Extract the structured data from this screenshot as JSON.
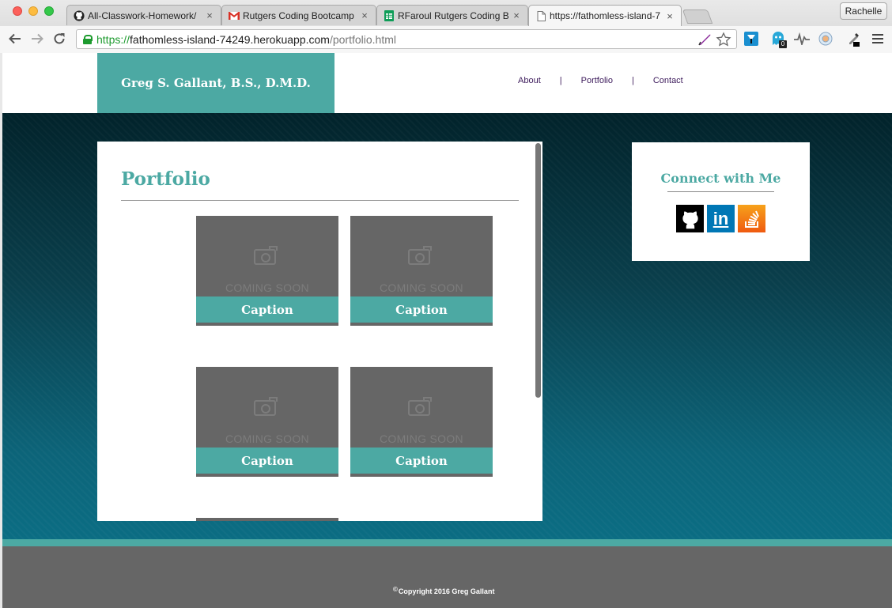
{
  "browser": {
    "tabs": [
      {
        "title": "All-Classwork-Homework/",
        "icon": "github-icon"
      },
      {
        "title": "Rutgers Coding Bootcamp",
        "icon": "gmail-icon"
      },
      {
        "title": "RFaroul Rutgers Coding Bo",
        "icon": "sheets-icon"
      },
      {
        "title": "https://fathomless-island-7",
        "icon": "page-icon"
      }
    ],
    "active_tab": 3,
    "close_glyph": "×",
    "profile_name": "Rachelle",
    "url_scheme": "https://",
    "url_host": "fathomless-island-74249.herokuapp.com",
    "url_path": "/portfolio.html",
    "extension_badge": "0",
    "colors": {
      "secure_green": "#1e9b2f"
    }
  },
  "site": {
    "brand": "Greg S. Gallant, B.S., D.M.D.",
    "nav": {
      "about": "About",
      "portfolio": "Portfolio",
      "contact": "Contact",
      "separator": "|"
    },
    "portfolio": {
      "title": "Portfolio",
      "items": [
        {
          "placeholder": "COMING SOON",
          "caption": "Caption"
        },
        {
          "placeholder": "COMING SOON",
          "caption": "Caption"
        },
        {
          "placeholder": "COMING SOON",
          "caption": "Caption"
        },
        {
          "placeholder": "COMING SOON",
          "caption": "Caption"
        }
      ]
    },
    "connect": {
      "title": "Connect with Me",
      "linkedin_glyph": "in",
      "icons": [
        "github-icon",
        "linkedin-icon",
        "stackoverflow-icon"
      ]
    },
    "footer": {
      "copyright_symbol": "©",
      "copyright": "Copyright 2016 Greg Gallant"
    },
    "colors": {
      "accent": "#4ca9a3",
      "nav_text": "#3c1a5b",
      "footer_bg": "#666666",
      "hero_dark": "#02232b",
      "hero_light": "#0b6d83"
    }
  }
}
